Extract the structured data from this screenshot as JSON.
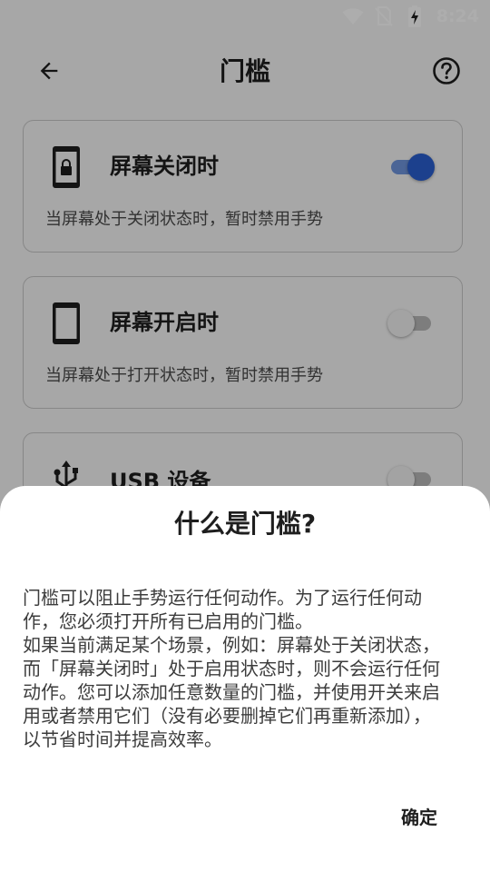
{
  "status_bar": {
    "time": "8:24",
    "icons": [
      "wifi-icon",
      "no-sim-icon",
      "battery-charging-icon"
    ]
  },
  "app_bar": {
    "title": "门槛",
    "back_icon": "arrow-back-icon",
    "help_icon": "help-circle-icon"
  },
  "cards": [
    {
      "icon": "phone-locked-icon",
      "title": "屏幕关闭时",
      "description": "当屏幕处于关闭状态时，暂时禁用手势",
      "toggle_on": true
    },
    {
      "icon": "phone-icon",
      "title": "屏幕开启时",
      "description": "当屏幕处于打开状态时，暂时禁用手势",
      "toggle_on": false
    },
    {
      "icon": "usb-icon",
      "title": "USB 设备",
      "description": "",
      "toggle_on": false
    }
  ],
  "dialog": {
    "title": "什么是门槛?",
    "body": "门槛可以阻止手势运行任何动作。为了运行任何动\n作，您必须打开所有已启用的门槛。\n如果当前满足某个场景，例如：屏幕处于关闭状态，\n而「屏幕关闭时」处于启用状态时，则不会运行任何\n动作。您可以添加任意数量的门槛，并使用开关来启\n用或者禁用它们（没有必要删掉它们再重新添加），\n以节省时间并提高效率。",
    "confirm_label": "确定"
  },
  "colors": {
    "accent": "#2a5fd0",
    "background": "#f6f6f6",
    "scrim": "rgba(0,0,0,0.32)"
  }
}
